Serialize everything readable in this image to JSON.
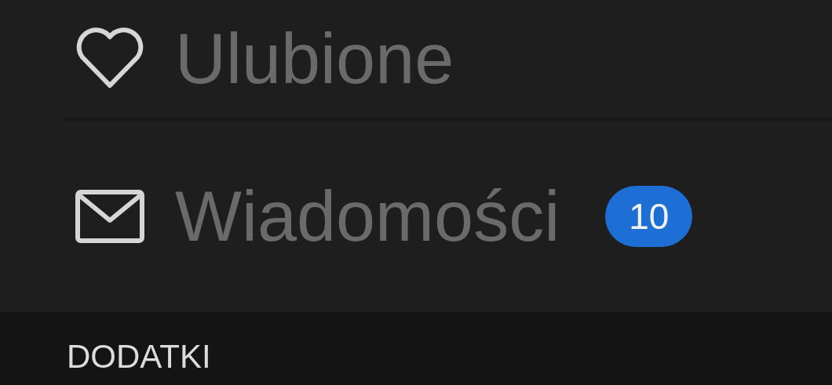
{
  "menu_items": [
    {
      "kind": "favorites",
      "label": "Ulubione"
    },
    {
      "kind": "messages",
      "label": "Wiadomości",
      "badge": "10"
    }
  ],
  "section_header": "DODATKI"
}
